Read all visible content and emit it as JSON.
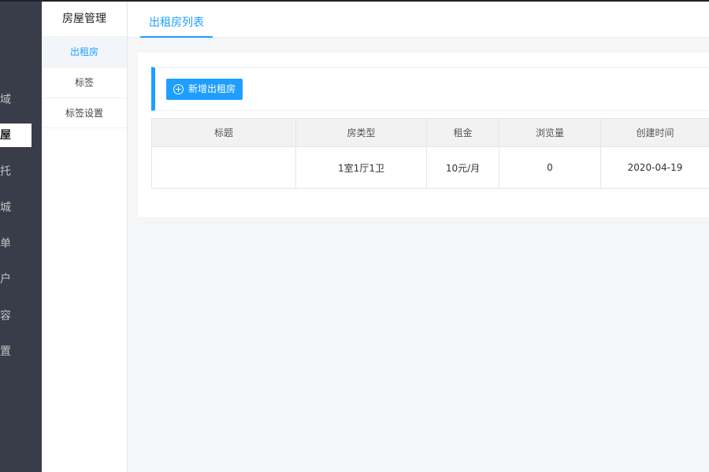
{
  "main_nav": {
    "items": [
      {
        "label": "区域",
        "active": false
      },
      {
        "label": "房屋",
        "active": true
      },
      {
        "label": "委托",
        "active": false
      },
      {
        "label": "商城",
        "active": false
      },
      {
        "label": "订单",
        "active": false
      },
      {
        "label": "用户",
        "active": false
      },
      {
        "label": "内容",
        "active": false
      },
      {
        "label": "设置",
        "active": false
      }
    ]
  },
  "sub_nav": {
    "title": "房屋管理",
    "items": [
      {
        "label": "出租房",
        "active": true
      },
      {
        "label": "标签",
        "active": false
      },
      {
        "label": "标签设置",
        "active": false
      }
    ]
  },
  "tabs": [
    {
      "label": "出租房列表",
      "active": true
    }
  ],
  "toolbar": {
    "add_button_label": "新增出租房",
    "add_icon": "plus-circle-icon"
  },
  "table": {
    "columns": [
      "标题",
      "房类型",
      "租金",
      "浏览量",
      "创建时间"
    ],
    "rows": [
      [
        "",
        "1室1厅1卫",
        "10元/月",
        "0",
        "2020-04-19"
      ]
    ]
  },
  "colors": {
    "accent": "#1e9fff",
    "nav_bg": "#393d49",
    "page_bg": "#f5f6f8"
  }
}
